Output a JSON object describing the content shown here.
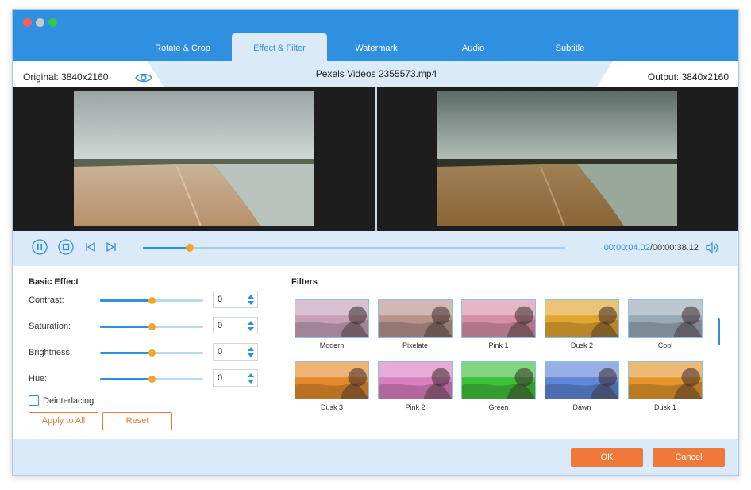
{
  "tabs": [
    {
      "label": "Rotate & Crop",
      "active": false
    },
    {
      "label": "Effect & Filter",
      "active": true
    },
    {
      "label": "Watermark",
      "active": false
    },
    {
      "label": "Audio",
      "active": false
    },
    {
      "label": "Subtitle",
      "active": false
    }
  ],
  "info": {
    "original": "Original: 3840x2160",
    "filename": "Pexels Videos 2355573.mp4",
    "output": "Output: 3840x2160"
  },
  "playback": {
    "current_time": "00:00:04.02",
    "total_time": "/00:00:38.12",
    "progress_fraction": 0.11
  },
  "basic_effect": {
    "title": "Basic Effect",
    "params": [
      {
        "label": "Contrast:",
        "value": "0",
        "level": 0.5
      },
      {
        "label": "Saturation:",
        "value": "0",
        "level": 0.5
      },
      {
        "label": "Brightness:",
        "value": "0",
        "level": 0.5
      },
      {
        "label": "Hue:",
        "value": "0",
        "level": 0.5
      }
    ],
    "deinterlacing_label": "Deinterlacing",
    "deinterlacing_checked": false,
    "apply_all_label": "Apply to All",
    "reset_label": "Reset"
  },
  "filters": {
    "title": "Filters",
    "items": [
      {
        "name": "Modern",
        "tint": "#c7a0b8"
      },
      {
        "name": "Pixelate",
        "tint": "#b8938c"
      },
      {
        "name": "Pink 1",
        "tint": "#d78fa8"
      },
      {
        "name": "Dusk 2",
        "tint": "#e2a530"
      },
      {
        "name": "Cool",
        "tint": "#9aa9b6"
      },
      {
        "name": "Dusk 3",
        "tint": "#e58a2c"
      },
      {
        "name": "Pink 2",
        "tint": "#d97fc0"
      },
      {
        "name": "Green",
        "tint": "#3fbf3a"
      },
      {
        "name": "Dawn",
        "tint": "#5f86d8"
      },
      {
        "name": "Dusk 1",
        "tint": "#e2952b"
      }
    ]
  },
  "footer": {
    "ok_label": "OK",
    "cancel_label": "Cancel"
  },
  "colors": {
    "accent": "#2f8fe0",
    "orange": "#f07838",
    "slider_thumb": "#f3a623"
  }
}
